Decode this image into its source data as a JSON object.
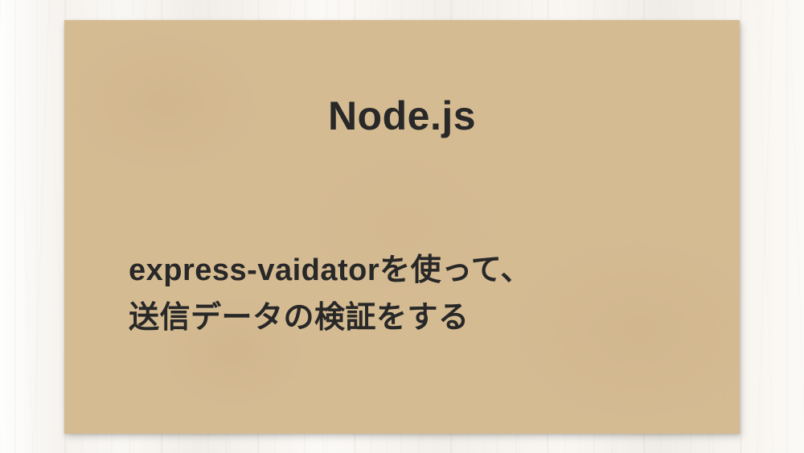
{
  "card": {
    "title": "Node.js",
    "subtitle_line1": "express-vaidatorを使って、",
    "subtitle_line2": "送信データの検証をする"
  }
}
